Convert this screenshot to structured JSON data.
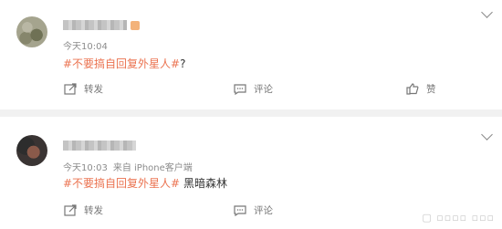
{
  "posts": [
    {
      "time": "今天10:04",
      "source": "",
      "hashtag": "#不要搞自回复外星人#",
      "suffix": "?",
      "actions": {
        "repost": "转发",
        "comment": "评论",
        "like": "赞"
      }
    },
    {
      "time": "今天10:03",
      "source": "来自 iPhone客户端",
      "hashtag": "#不要搞自回复外星人#",
      "suffix": " 黑暗森林",
      "actions": {
        "repost": "转发",
        "comment": "评论"
      }
    }
  ],
  "icons": {
    "more": "chevron-down-icon",
    "repost": "repost-icon",
    "comment": "comment-icon",
    "like": "thumbs-up-icon"
  },
  "colors": {
    "hashtag": "#eb7350",
    "text": "#333333",
    "meta": "#8c8c8c",
    "background": "#f1f1f1"
  }
}
